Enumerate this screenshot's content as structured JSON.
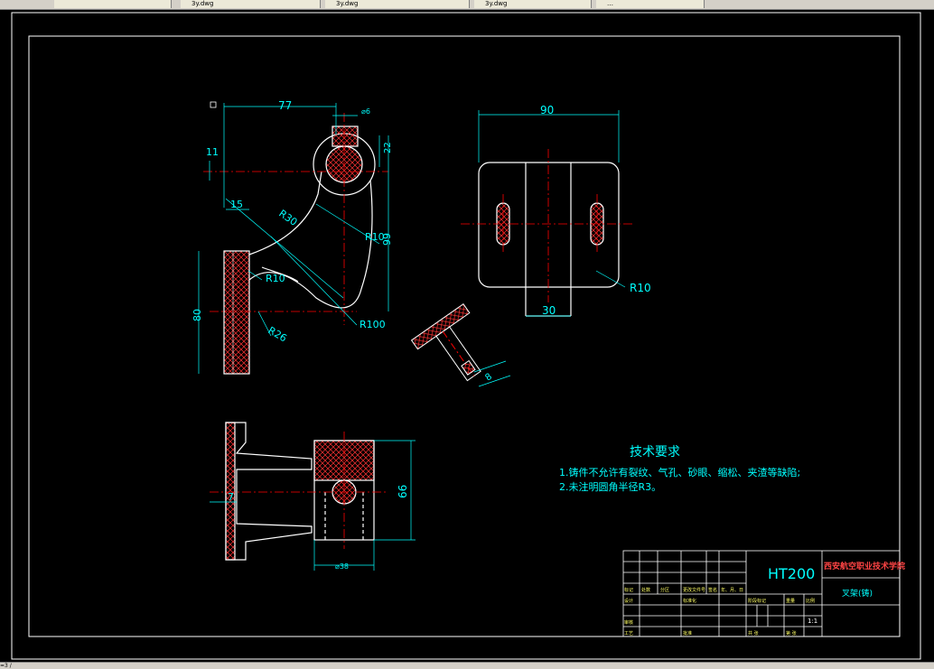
{
  "tabs": [
    {
      "label": ""
    },
    {
      "label": "3y.dwg"
    },
    {
      "label": "3y.dwg"
    },
    {
      "label": "3y.dwg"
    },
    {
      "label": "…"
    }
  ],
  "dims": {
    "d77": "77",
    "d6": "⌀6",
    "d11": "11",
    "d22": "22",
    "d15": "15",
    "r30": "R30",
    "r10a": "R10",
    "r10b": "R10",
    "d99": "99",
    "d80": "80",
    "r26": "R26",
    "r100": "R100",
    "d90": "90",
    "d30": "30",
    "r10c": "R10",
    "d8": "8",
    "d7": "7",
    "d66": "66",
    "d38": "⌀38"
  },
  "notes": {
    "title": "技术要求",
    "line1": "1.铸件不允许有裂纹、气孔、砂眼、缩松、夹渣等缺陷;",
    "line2": "2.未注明圆角半径R3。"
  },
  "title_block": {
    "material": "HT200",
    "school": "西安航空职业技术学院",
    "part_name": "叉架(铸)",
    "scale": "1:1",
    "row_labels": [
      "标记",
      "处数",
      "分区",
      "更改文件号",
      "签名",
      "年、月、日"
    ],
    "designer": "设计",
    "standard": "标准化",
    "stage": "阶段标记",
    "weight": "重量",
    "ratio": "比例",
    "review": "审核",
    "process": "工艺",
    "approve": "批准",
    "sheets": "共 张",
    "sheet": "第 张"
  },
  "status": {
    "text": "=3 /"
  },
  "colors": {
    "line": "#ffffff",
    "dim": "#00ffff",
    "center": "#ff0000",
    "bg": "#000000",
    "hatch": "#ff3333"
  }
}
